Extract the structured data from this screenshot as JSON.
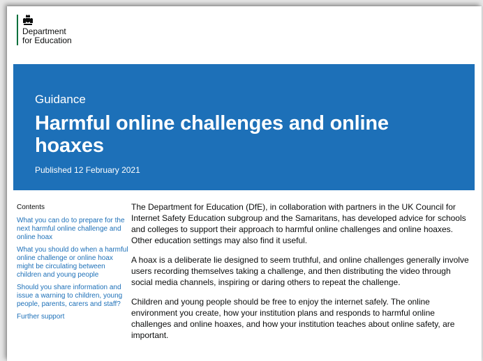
{
  "header": {
    "org_line1": "Department",
    "org_line2": "for Education"
  },
  "hero": {
    "kicker": "Guidance",
    "title": "Harmful online challenges and online hoaxes",
    "published": "Published 12 February 2021"
  },
  "contents": {
    "heading": "Contents",
    "links": [
      "What you can do to prepare for the next harmful online challenge and online hoax",
      "What you should do when a harmful online challenge or online hoax might be circulating between children and young people",
      "Should you share information and issue a warning to children, young people, parents, carers and staff?",
      "Further support"
    ]
  },
  "body": {
    "paragraphs": [
      "The Department for Education (DfE), in collaboration with partners in the UK Council for Internet Safety Education subgroup and the Samaritans, has developed advice for schools and colleges to support their approach to harmful online challenges and online hoaxes. Other education settings may also find it useful.",
      "A hoax is a deliberate lie designed to seem truthful, and online challenges generally involve users recording themselves taking a challenge, and then distributing the video through social media channels, inspiring or daring others to repeat the challenge.",
      "Children and young people should be free to enjoy the internet safely. The online environment you create, how your institution plans and responds to harmful online challenges and online hoaxes, and how your institution teaches about online safety, are important."
    ]
  },
  "colors": {
    "brand_blue": "#1d70b8",
    "dfe_green": "#00703c",
    "text": "#0b0c0c"
  },
  "icons": {
    "crest": "royal-coat-of-arms-icon"
  }
}
